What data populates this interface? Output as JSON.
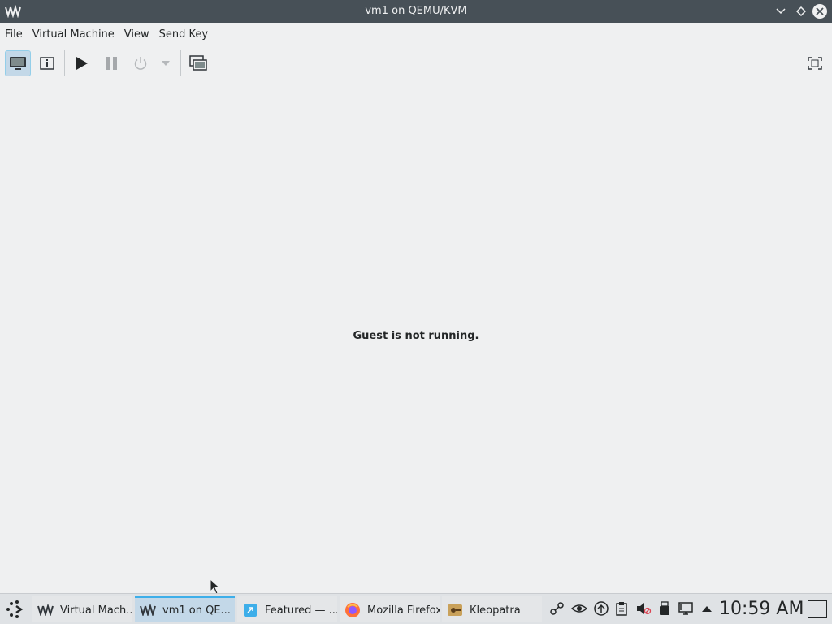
{
  "window": {
    "title": "vm1 on QEMU/KVM",
    "app_icon": "virt-manager-logo-icon"
  },
  "menubar": {
    "items": [
      "File",
      "Virtual Machine",
      "View",
      "Send Key"
    ]
  },
  "toolbar": {
    "buttons": [
      {
        "name": "console-view",
        "icon": "monitor-icon",
        "active": true
      },
      {
        "name": "details-view",
        "icon": "info-icon"
      },
      {
        "name": "run",
        "icon": "play-icon"
      },
      {
        "name": "pause",
        "icon": "pause-icon"
      },
      {
        "name": "shutdown",
        "icon": "power-icon"
      },
      {
        "name": "shutdown-menu",
        "icon": "chevron-down-icon"
      },
      {
        "name": "snapshots",
        "icon": "snapshots-icon"
      },
      {
        "name": "fullscreen",
        "icon": "fullscreen-icon"
      }
    ]
  },
  "content": {
    "message": "Guest is not running."
  },
  "taskbar": {
    "tasks": [
      {
        "label": "Virtual Mach...",
        "icon": "virt-manager-icon",
        "active": false
      },
      {
        "label": "vm1 on QE...",
        "icon": "virt-manager-icon",
        "active": true
      },
      {
        "label": "Featured — ...",
        "icon": "discover-icon",
        "active": false
      },
      {
        "label": "Mozilla Firefox",
        "icon": "firefox-icon",
        "active": false
      },
      {
        "label": "Kleopatra",
        "icon": "kleopatra-icon",
        "active": false
      }
    ],
    "tray_icons": [
      "network-share-icon",
      "eye-icon",
      "update-icon",
      "clipboard-icon",
      "volume-muted-icon",
      "usb-icon",
      "display-icon",
      "expand-tray-icon"
    ],
    "clock": "10:59 AM"
  },
  "colors": {
    "titlebar": "#475057",
    "accent": "#3daee9",
    "active_task": "#c3d8e8"
  }
}
